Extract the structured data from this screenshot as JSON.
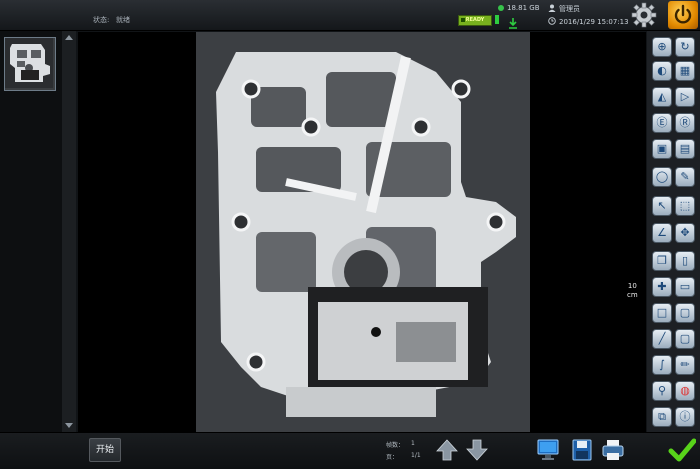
{
  "status": {
    "label": "状态:",
    "value": "就绪"
  },
  "system": {
    "disk": "18.81 GB",
    "user": "管理员",
    "ready": "READY",
    "datetime": "2016/1/29 15:07:13"
  },
  "viewer": {
    "scale_value": "10",
    "scale_unit": "cm"
  },
  "bottom": {
    "start_label": "开始",
    "count_label": "帧数：",
    "count_value": "1",
    "page_label": "页：",
    "page_value": "1/1"
  },
  "icons": [
    "gear-icon",
    "power-icon",
    "arrow-up-icon",
    "arrow-down-icon",
    "monitor-icon",
    "save-icon",
    "print-icon",
    "confirm-check-icon"
  ],
  "colors": {
    "accent_green": "#2ecc40",
    "ready_bg": "#78b11e",
    "power_orange": "#f0a000"
  }
}
